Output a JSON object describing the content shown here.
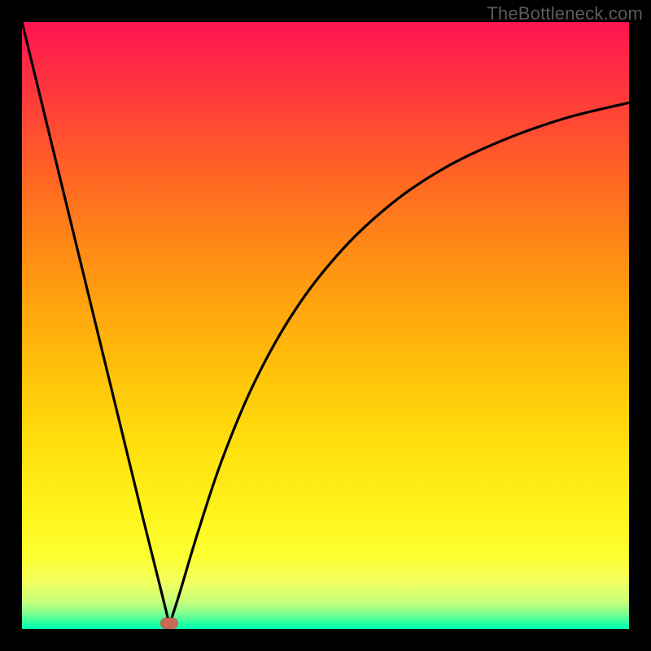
{
  "watermark": "TheBottleneck.com",
  "marker": {
    "x_frac": 0.243,
    "y_frac": 0.99
  },
  "colors": {
    "curve": "#000000",
    "marker": "#c96a56",
    "frame_bg": "#000000"
  },
  "chart_data": {
    "type": "line",
    "title": "",
    "xlabel": "",
    "ylabel": "",
    "xlim": [
      0,
      1
    ],
    "ylim": [
      0,
      1
    ],
    "note": "No axes, ticks, or labels are visible. The plot area has a vertical color gradient (red at top → yellow mid → green at bottom). A single V-shaped black curve dips to a minimum near x≈0.24, y≈0.99 (bottom) then rises toward the right. A small rounded marker sits at the minimum.",
    "series": [
      {
        "name": "curve",
        "x": [
          0.0,
          0.05,
          0.1,
          0.15,
          0.2,
          0.23,
          0.243,
          0.26,
          0.29,
          0.33,
          0.38,
          0.44,
          0.51,
          0.59,
          0.68,
          0.78,
          0.89,
          1.0
        ],
        "y": [
          0.0,
          0.205,
          0.41,
          0.615,
          0.82,
          0.94,
          0.993,
          0.94,
          0.84,
          0.72,
          0.6,
          0.49,
          0.395,
          0.315,
          0.25,
          0.2,
          0.16,
          0.133
        ]
      }
    ],
    "annotations": [
      {
        "type": "marker",
        "shape": "rounded-rect",
        "x": 0.243,
        "y": 0.99,
        "color": "#c96a56"
      }
    ]
  }
}
